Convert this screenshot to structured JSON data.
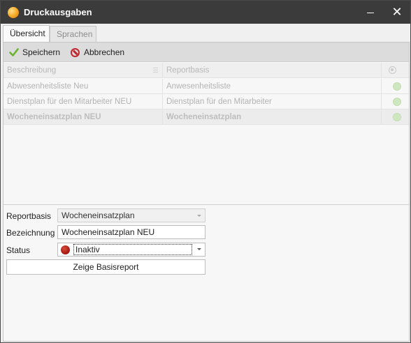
{
  "window": {
    "title": "Druckausgaben",
    "close_glyph": "✕"
  },
  "tabs": [
    {
      "label": "Übersicht",
      "active": true
    },
    {
      "label": "Sprachen",
      "active": false
    }
  ],
  "toolbar": {
    "save_label": "Speichern",
    "cancel_label": "Abbrechen"
  },
  "grid": {
    "columns": [
      "Beschreibung",
      "Reportbasis"
    ],
    "rows": [
      {
        "beschreibung": "Abwesenheitsliste Neu",
        "reportbasis": "Anwesenheitsliste",
        "selected": false
      },
      {
        "beschreibung": "Dienstplan für den Mitarbeiter NEU",
        "reportbasis": "Dienstplan für den Mitarbeiter",
        "selected": false
      },
      {
        "beschreibung": "Wocheneinsatzplan NEU",
        "reportbasis": "Wocheneinsatzplan",
        "selected": true
      }
    ]
  },
  "form": {
    "reportbasis_label": "Reportbasis",
    "reportbasis_value": "Wocheneinsatzplan",
    "bezeichnung_label": "Bezeichnung",
    "bezeichnung_value": "Wocheneinsatzplan NEU",
    "status_label": "Status",
    "status_value": "Inaktiv",
    "base_report_button": "Zeige Basisreport"
  },
  "colors": {
    "titlebar": "#3b3b3b",
    "status_inactive": "#a3160f",
    "status_active_dot": "#cfe7c0",
    "save_check": "#6bb22f",
    "cancel_red": "#c0262d"
  }
}
